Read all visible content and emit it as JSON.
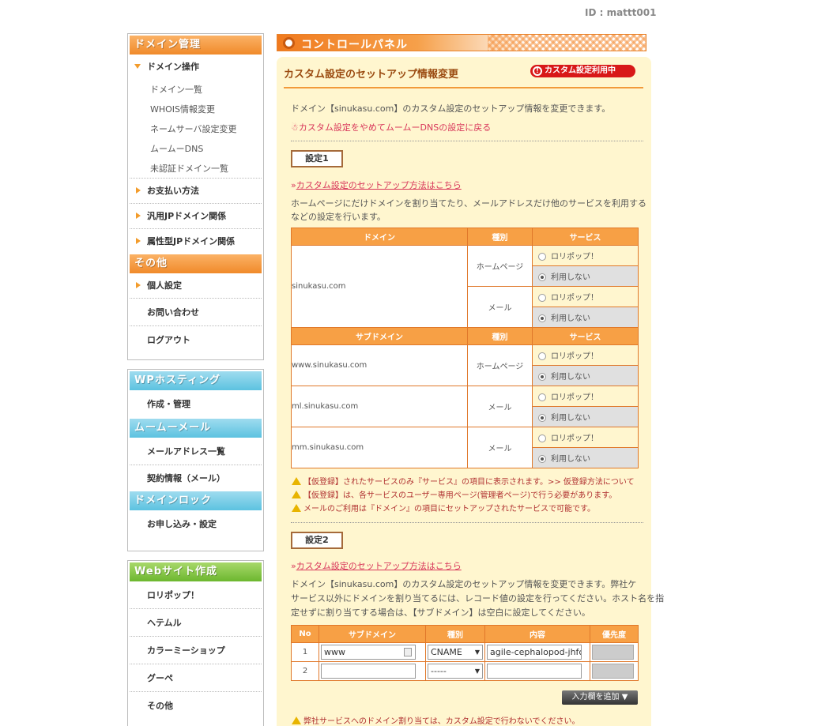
{
  "user_id": "ID : mattt001",
  "sidebar": {
    "domain_header": "ドメイン管理",
    "domain_ops": "ドメイン操作",
    "domain_sub": [
      "ドメイン一覧",
      "WHOIS情報変更",
      "ネームサーバ設定変更",
      "ムームーDNS",
      "未認証ドメイン一覧"
    ],
    "payment": "お支払い方法",
    "general_jp": "汎用JPドメイン関係",
    "attr_jp": "属性型JPドメイン関係",
    "other_header": "その他",
    "personal": "個人設定",
    "contact": "お問い合わせ",
    "logout": "ログアウト",
    "wp_header": "WPホスティング",
    "wp_create": "作成・管理",
    "mail_header": "ムームーメール",
    "mail_list": "メールアドレス一覧",
    "mail_contract": "契約情報（メール）",
    "lock_header": "ドメインロック",
    "lock_apply": "お申し込み・設定",
    "web_header": "Webサイト作成",
    "web_items": [
      "ロリポップ！",
      "ヘテムル",
      "カラーミーショップ",
      "グーペ",
      "その他"
    ]
  },
  "cp_title": "コントロールパネル",
  "panel": {
    "title": "カスタム設定のセットアップ情報変更",
    "badge": "カスタム設定利用中",
    "intro": "ドメイン【sinukasu.com】のカスタム設定のセットアップ情報を変更できます。",
    "back_link": "カスタム設定をやめてムームーDNSの設定に戻る",
    "s1_label": "設定1",
    "s1_howto": "カスタム設定のセットアップ方法はこちら",
    "s1_desc1": "ホームページにだけドメインを割り当てたり、メールアドレスだけ他のサービスを利用する",
    "s1_desc2": "などの設定を行います。",
    "th_domain": "ドメイン",
    "th_kind": "種別",
    "th_service": "サービス",
    "th_subdomain": "サブドメイン",
    "domain": "sinukasu.com",
    "kind_hp": "ホームページ",
    "kind_mail": "メール",
    "opt_lolipop": "ロリポップ！",
    "opt_none": "利用しない",
    "sub1": "www.sinukasu.com",
    "sub2": "ml.sinukasu.com",
    "sub3": "mm.sinukasu.com",
    "warn1": "【仮登録】されたサービスのみ『サービス』の項目に表示されます。>> 仮登録方法について",
    "warn2": "【仮登録】は、各サービスのユーザー専用ページ(管理者ページ)で行う必要があります。",
    "warn3": "メールのご利用は『ドメイン』の項目にセットアップされたサービスで可能です。",
    "s2_label": "設定2",
    "s2_howto": "カスタム設定のセットアップ方法はこちら",
    "s2_desc1": "ドメイン【sinukasu.com】のカスタム設定のセットアップ情報を変更できます。弊社ケ",
    "s2_desc2": "サービス以外にドメインを割り当てるには、レコード値の設定を行ってください。ホスト名を指",
    "s2_desc3": "定せずに割り当てする場合は、【サブドメイン】は空白に設定してください。",
    "th_no": "No",
    "th_content": "内容",
    "th_priority": "優先度",
    "rows": [
      {
        "no": "1",
        "sub": "www",
        "kind": "CNAME",
        "content": "agile-cephalopod-jhfc"
      },
      {
        "no": "2",
        "sub": "",
        "kind": "-----",
        "content": ""
      }
    ],
    "add_button": "入力欄を追加",
    "warn4": "弊社サービスへのドメイン割り当ては、カスタム設定で行わないでください。"
  }
}
